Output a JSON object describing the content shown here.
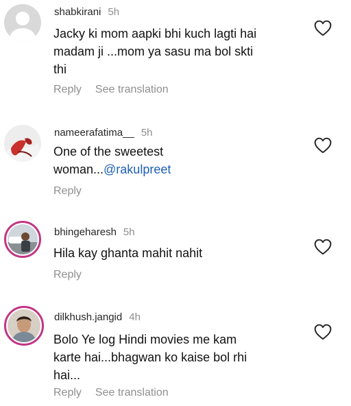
{
  "comments": [
    {
      "username": "shabkirani",
      "time": "5h",
      "lines": [
        "Jacky ki mom aapki bhi kuch lagti hai",
        "madam ji ...mom ya sasu ma bol skti",
        "thi"
      ],
      "reply_label": "Reply",
      "translate_label": "See translation",
      "avatar_icon": "default-avatar-icon",
      "like_icon": "heart-outline-icon"
    },
    {
      "username": "nameerafatima__",
      "time": "5h",
      "line1": "One of the sweetest",
      "line2_prefix": "woman...",
      "mention": "@rakulpreet",
      "reply_label": "Reply",
      "like_icon": "heart-outline-icon"
    },
    {
      "username": "bhingeharesh",
      "time": "5h",
      "lines": [
        "Hila kay ghanta mahit nahit"
      ],
      "reply_label": "Reply",
      "like_icon": "heart-outline-icon"
    },
    {
      "username": "dilkhush.jangid",
      "time": "4h",
      "lines": [
        "Bolo Ye log Hindi movies me kam",
        "karte hai...bhagwan ko kaise bol rhi",
        "hai..."
      ],
      "reply_label": "Reply",
      "translate_label": "See translation",
      "like_icon": "heart-outline-icon"
    }
  ],
  "colors": {
    "text": "#111111",
    "muted": "#8e8e8e",
    "mention": "#1d5fb4",
    "story_ring": "#c13584"
  }
}
